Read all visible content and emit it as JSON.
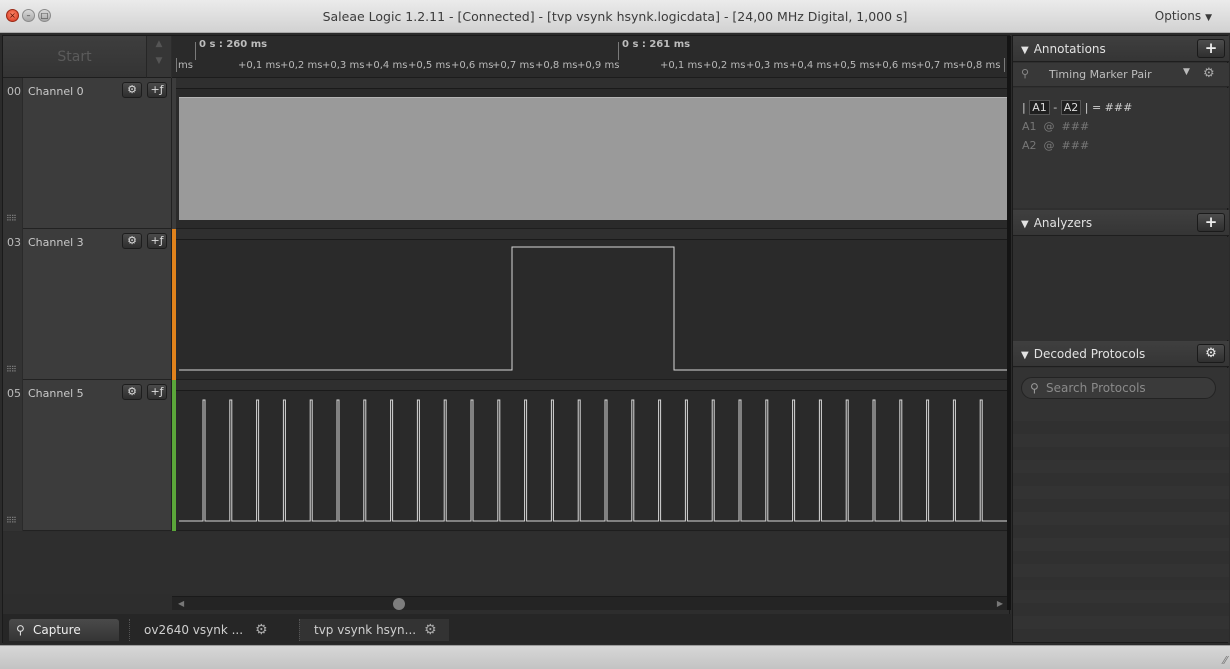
{
  "window": {
    "title": "Saleae Logic 1.2.11 - [Connected] - [tvp vsynk hsynk.logicdata] - [24,00 MHz Digital, 1,000 s]",
    "options_label": "Options"
  },
  "toolbar": {
    "start_label": "Start"
  },
  "ruler": {
    "major_labels": [
      "0 s : 260 ms",
      "0 s : 261 ms"
    ],
    "sub_labels_first": [
      "ms",
      "+0,1 ms",
      "+0,2 ms",
      "+0,3 ms",
      "+0,4 ms",
      "+0,5 ms",
      "+0,6 ms",
      "+0,7 ms",
      "+0,8 ms",
      "+0,9 ms"
    ],
    "sub_labels_second": [
      "+0,1 ms",
      "+0,2 ms",
      "+0,3 ms",
      "+0,4 ms",
      "+0,5 ms",
      "+0,6 ms",
      "+0,7 ms",
      "+0,8 ms"
    ]
  },
  "channels": [
    {
      "number": "00",
      "name": "Channel 0",
      "color": "#3c3c3c",
      "signal": "high"
    },
    {
      "number": "03",
      "name": "Channel 3",
      "color": "#e0821c",
      "signal": "pulse"
    },
    {
      "number": "05",
      "name": "Channel 5",
      "color": "#5ba63a",
      "signal": "clock"
    }
  ],
  "tabs": [
    {
      "label": "Capture"
    },
    {
      "label": "ov2640 vsynk ..."
    },
    {
      "label": "tvp vsynk hsyn..."
    }
  ],
  "annotations": {
    "title": "Annotations",
    "marker_pair": "Timing Marker Pair",
    "line1_a1": "A1",
    "line1_a2": "A2",
    "line1_value": "= ###",
    "a1_label": "A1",
    "a2_label": "A2",
    "at": "@",
    "placeholder": "###"
  },
  "analyzers": {
    "title": "Analyzers"
  },
  "decoded": {
    "title": "Decoded Protocols",
    "search_placeholder": "Search Protocols"
  }
}
